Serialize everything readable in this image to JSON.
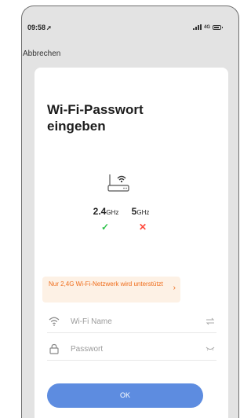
{
  "status_bar": {
    "time": "09:58",
    "network": "4G"
  },
  "nav": {
    "cancel_label": "Abbrechen"
  },
  "card": {
    "title": "Wi-Fi-Passwort eingeben",
    "bands": [
      {
        "value": "2.4",
        "unit": "GHz",
        "supported": true
      },
      {
        "value": "5",
        "unit": "GHz",
        "supported": false
      }
    ],
    "marks": {
      "ok": "✓",
      "no": "✕"
    },
    "warning": "Nur 2,4G Wi-Fi-Netzwerk wird unterstützt",
    "wifi_field": {
      "placeholder": "Wi-Fi Name",
      "value": ""
    },
    "password_field": {
      "placeholder": "Passwort",
      "value": ""
    },
    "ok_label": "OK"
  },
  "colors": {
    "accent": "#5d8ce0",
    "success": "#2ec24a",
    "error": "#ff4a3d",
    "warning_text": "#ef6c1a",
    "warning_bg": "#fdf1e5"
  },
  "icons": {
    "router": "router-icon",
    "wifi": "wifi-icon",
    "lock": "lock-icon",
    "switch": "switch-icon",
    "eye_closed": "eye-closed-icon",
    "chevron": "chevron-right-icon"
  }
}
